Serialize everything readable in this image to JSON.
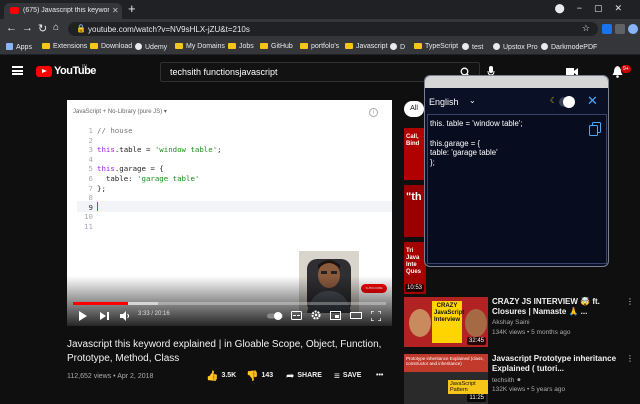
{
  "browser": {
    "tab_title": "(675) Javascript this keyword exp",
    "tab_close": "✕",
    "new_tab": "+",
    "url": "youtube.com/watch?v=NV9sHLX-jZU&t=210s",
    "bookmarks": [
      "Apps",
      "Extensions",
      "Download",
      "Udemy",
      "My Domains",
      "Jobs",
      "GitHub",
      "portfolo's",
      "Javascript",
      "D",
      "TypeScript",
      "test",
      "Upstox Pro",
      "DarkmodePDF"
    ]
  },
  "youtube": {
    "logo_text": "YouTube",
    "country": "IN",
    "search_query": "techsith functionsjavascript",
    "notification_count": "9+"
  },
  "player": {
    "editor_header": "JavaScript + No-Library (pure JS) ▾",
    "code_lines": [
      {
        "n": "1",
        "parts": [
          {
            "c": "cm",
            "t": "// house"
          }
        ]
      },
      {
        "n": "2",
        "parts": []
      },
      {
        "n": "3",
        "parts": [
          {
            "c": "kw",
            "t": "this"
          },
          {
            "c": "txt",
            "t": ".table = "
          },
          {
            "c": "str",
            "t": "'window table'"
          },
          {
            "c": "txt",
            "t": ";"
          }
        ]
      },
      {
        "n": "4",
        "parts": []
      },
      {
        "n": "5",
        "parts": [
          {
            "c": "kw",
            "t": "this"
          },
          {
            "c": "txt",
            "t": ".garage = {"
          }
        ]
      },
      {
        "n": "6",
        "parts": [
          {
            "c": "txt",
            "t": "  table: "
          },
          {
            "c": "str",
            "t": "'garage table'"
          }
        ]
      },
      {
        "n": "7",
        "parts": [
          {
            "c": "txt",
            "t": "};"
          }
        ]
      },
      {
        "n": "8",
        "parts": []
      },
      {
        "n": "9",
        "parts": []
      },
      {
        "n": "10",
        "parts": []
      },
      {
        "n": "11",
        "parts": []
      }
    ],
    "active_line": "9",
    "subscribe_label": "SUBSCRIBE",
    "timecode": "3:33 / 20:16",
    "progress": 0.175,
    "buffered": 0.27
  },
  "video": {
    "title": "Javascript this keyword explained | in Gloable Scope, Object, Function, Prototype, Method, Class",
    "views": "112,652 views",
    "date": "Apr 2, 2018",
    "separator": " • ",
    "likes": "3.5K",
    "dislikes": "143",
    "share_label": "SHARE",
    "save_label": "SAVE",
    "more": "•••"
  },
  "sidebar": {
    "chip_all": "All",
    "partial_thumbs": [
      {
        "text": "Call, Bind"
      },
      {
        "text": "\"th"
      },
      {
        "text": "Tri Java Inte Ques"
      }
    ],
    "partial_duration": "10:53",
    "cards": [
      {
        "title": "CRAZY JS INTERVIEW 🤯 ft. Closures | Namaste 🙏 ...",
        "channel": "Akshay Saini",
        "stats": "134K views • 5 months ago",
        "thumb_text": "CRAZY JavaScript Interview",
        "duration": "32:45"
      },
      {
        "title": "Javascript Prototype inheritance Explained ( tutori...",
        "channel": "techsith ⚫",
        "stats": "132K views • 5 years ago",
        "thumb_text": "Prototype inheritance Explained (class, constructor and inheritance)",
        "thumb_text2": "JavaScript Pattern",
        "duration": "11:25"
      }
    ]
  },
  "popup": {
    "language": "English",
    "close": "✕",
    "lines": [
      "this. table = 'window table';",
      "",
      "this.garage = {",
      "table: 'garage table'",
      "};"
    ]
  },
  "colors": {
    "yt_red": "#ff0000",
    "popup_bg": "#0a1026",
    "popup_close": "#4aa8ff"
  }
}
